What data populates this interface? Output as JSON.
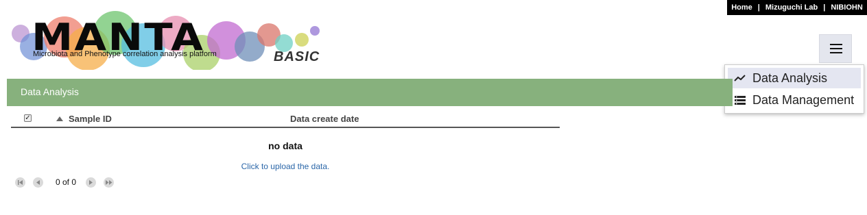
{
  "topnav": {
    "links": [
      "Home",
      "Mizuguchi Lab",
      "NIBIOHN"
    ],
    "separator": "|"
  },
  "logo": {
    "title": "MANTA",
    "subtitle": "Microbiota and Phenotype correlation analysis platform",
    "edition": "BASIC"
  },
  "menu": {
    "items": [
      {
        "label": "Data Analysis",
        "icon": "trending-line-icon",
        "active": true
      },
      {
        "label": "Data Management",
        "icon": "list-icon",
        "active": false
      }
    ]
  },
  "section": {
    "title": "Data Analysis"
  },
  "table": {
    "columns": [
      "Sample ID",
      "Data create date"
    ],
    "select_all_checked": true,
    "empty_text": "no data",
    "upload_link": "Click to upload the data."
  },
  "pager": {
    "info": "0 of 0"
  },
  "colors": {
    "header_bar": "#87b17d",
    "menu_active": "#e4e6f1",
    "link": "#2a66a8"
  }
}
